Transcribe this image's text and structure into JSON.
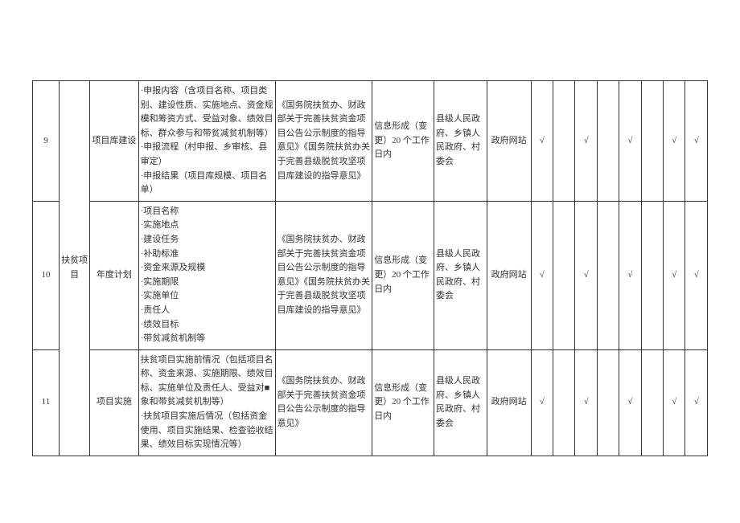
{
  "table": {
    "category": "扶贫项目",
    "rows": [
      {
        "idx": "9",
        "item": "项目库建设",
        "content": "·申报内容（含项目名称、项目类别、建设性质、实施地点、资金规模和筹资方式、受益对象、绩效目标、群众参与和带贫减贫机制等）\n·申报流程（村申报、乡审核、县审定）\n·申报结果（项目库规模、项目名单）",
        "basis": "《国务院扶贫办、财政部关于完善扶贫资金项目公告公示制度的指导意见》《国务院扶贫办关于完善县级脱贫攻坚项目库建设的指导意见》",
        "timing": "信息形成（变更）20 个工作日内",
        "subject": "县级人民政府、乡镇人民政府、村委会",
        "channel": "政府网站",
        "checks": [
          "√",
          "",
          "√",
          "",
          "√",
          "",
          "√",
          "√"
        ]
      },
      {
        "idx": "10",
        "item": "年度计划",
        "content": "·项目名称\n·实施地点\n·建设任务\n·补助标准\n·资金来源及规模\n·实施期限\n·实施单位\n·责任人\n·绩效目标\n·带贫减贫机制等",
        "basis": "《国务院扶贫办、财政部关于完善扶贫资金项目公告公示制度的指导意见》《国务院扶贫办关于完善县级脱贫攻坚项目库建设的指导意见》",
        "timing": "信息形成（变更）20 个工作日内",
        "subject": "县级人民政府、乡镇人民政府、村委会",
        "channel": "政府网站",
        "checks": [
          "√",
          "",
          "√",
          "",
          "√",
          "",
          "√",
          "√"
        ]
      },
      {
        "idx": "11",
        "item": "项目实施",
        "content": "扶贫项目实施前情况（包括项目名称、资金来源、实施期限、绩效目标、实施单位及责任人、受益对■象和带贫减贫机制等）\n·扶贫项目实施后情况（包括资金使用、项目实施结果、检查验收结果、绩效目标实现情况等）",
        "basis": "《国务院扶贫办、财政部关于完善扶贫资金项目公告公示制度的指导意见》",
        "timing": "信息形成（变更）20 个工作日内",
        "subject": "县级人民政府、乡镇人民政府、村委会",
        "channel": "政府网站",
        "checks": [
          "√",
          "",
          "√",
          "",
          "√",
          "",
          "√",
          "√"
        ]
      }
    ]
  }
}
